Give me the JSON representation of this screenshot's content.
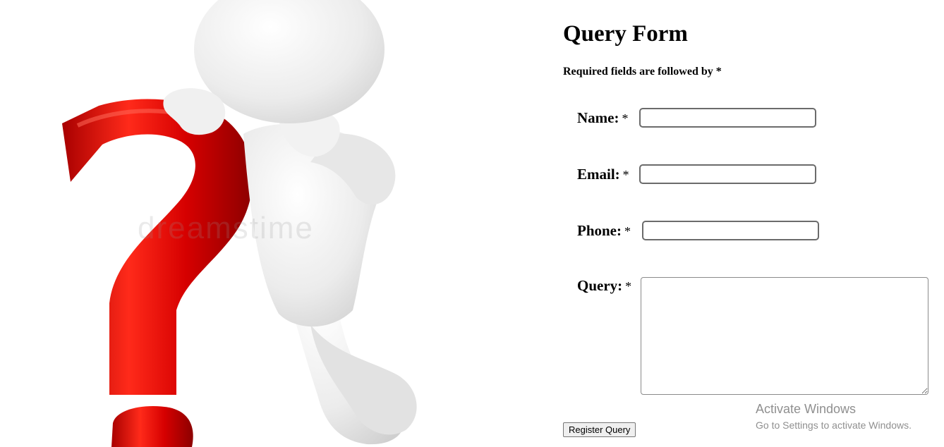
{
  "form": {
    "title": "Query Form",
    "required_note": "Required fields are followed by *",
    "fields": {
      "name": {
        "label": "Name:",
        "required_mark": "*",
        "value": ""
      },
      "email": {
        "label": "Email:",
        "required_mark": "*",
        "value": ""
      },
      "phone": {
        "label": "Phone:",
        "required_mark": "*",
        "value": ""
      },
      "query": {
        "label": "Query:",
        "required_mark": "*",
        "value": ""
      }
    },
    "submit_label": "Register Query"
  },
  "illustration": {
    "subject": "white 3d figure leaning on red question mark",
    "watermark": "dreamstime"
  },
  "os_overlay": {
    "title": "Activate Windows",
    "subtitle": "Go to Settings to activate Windows."
  },
  "colors": {
    "question_mark": "#d90000",
    "figure": "#eeeeee",
    "input_border": "#6b6b6b"
  }
}
